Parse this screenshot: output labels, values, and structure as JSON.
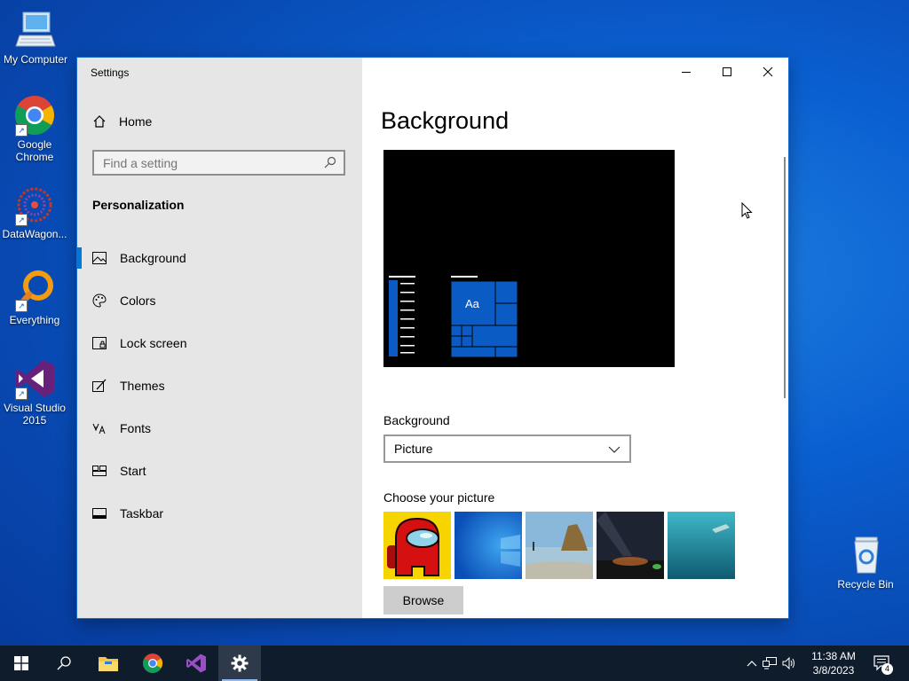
{
  "desktop": {
    "icons": [
      {
        "label": "My Computer"
      },
      {
        "label": "Google Chrome"
      },
      {
        "label": "DataWagon..."
      },
      {
        "label": "Everything"
      },
      {
        "label": "Visual Studio 2015"
      },
      {
        "label": "Recycle Bin"
      }
    ]
  },
  "window": {
    "title": "Settings",
    "home_label": "Home",
    "search_placeholder": "Find a setting",
    "section_label": "Personalization",
    "nav": [
      {
        "label": "Background",
        "icon": "picture-icon",
        "active": true
      },
      {
        "label": "Colors",
        "icon": "palette-icon"
      },
      {
        "label": "Lock screen",
        "icon": "lock-screen-icon"
      },
      {
        "label": "Themes",
        "icon": "themes-icon"
      },
      {
        "label": "Fonts",
        "icon": "fonts-icon"
      },
      {
        "label": "Start",
        "icon": "start-icon"
      },
      {
        "label": "Taskbar",
        "icon": "taskbar-icon"
      }
    ]
  },
  "main": {
    "title": "Background",
    "preview_tile_label": "Aa",
    "background_label": "Background",
    "background_value": "Picture",
    "choose_label": "Choose your picture",
    "browse_label": "Browse"
  },
  "taskbar": {
    "clock_time": "11:38 AM",
    "clock_date": "3/8/2023",
    "notification_count": "4"
  },
  "colors": {
    "accent": "#0078d7",
    "desktop": "#0a5fd0",
    "taskbar": "#0f1c2c",
    "sidebar": "#e6e6e6"
  }
}
